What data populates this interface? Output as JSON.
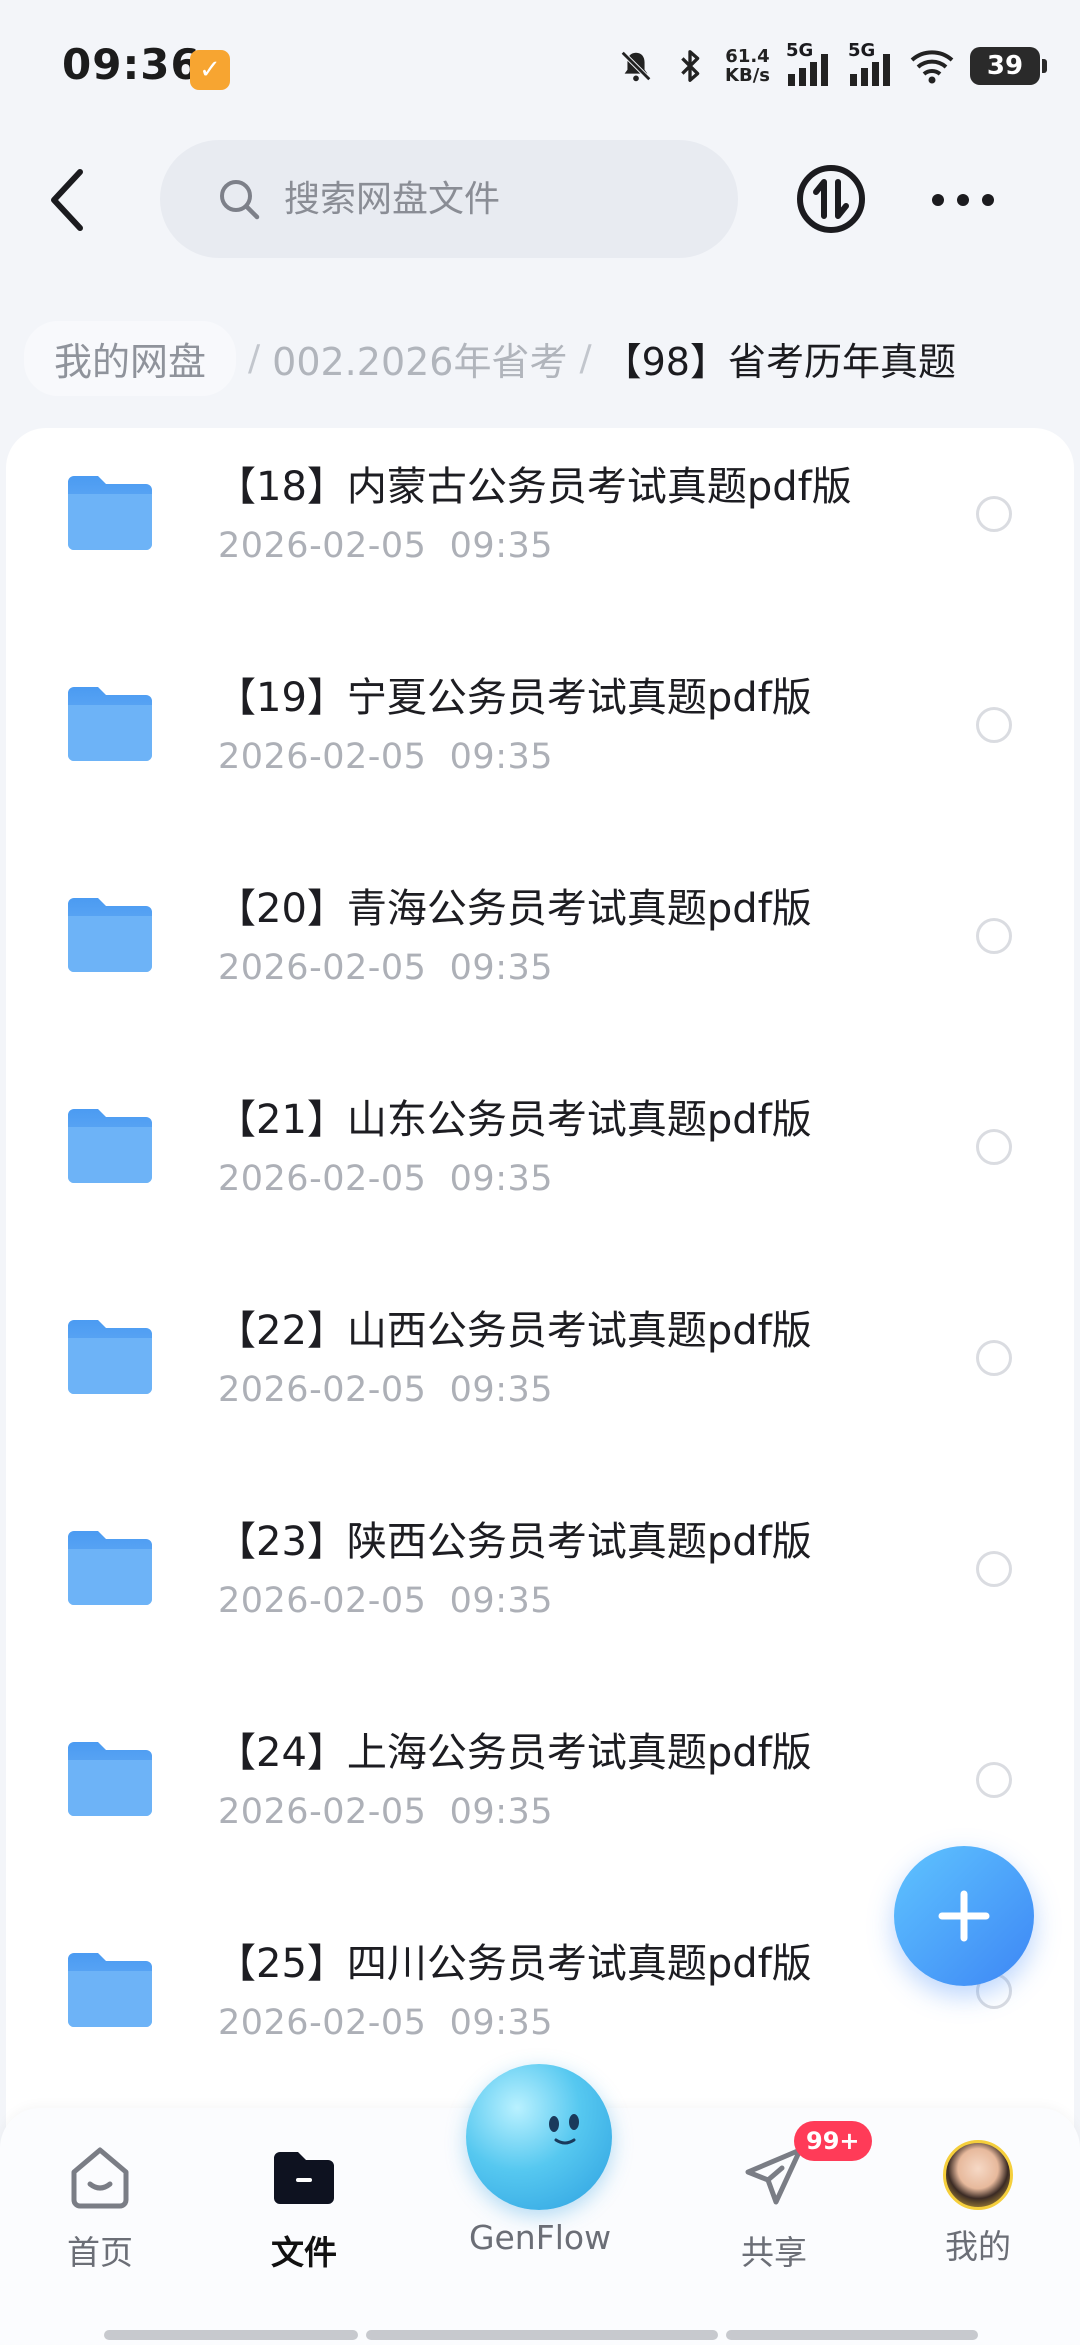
{
  "status_bar": {
    "time": "09:36",
    "app_badge_icon": "app-notification-icon",
    "net_speed_value": "61.4",
    "net_speed_unit": "KB/s",
    "signal1": "5G",
    "signal2": "5G",
    "battery": "39"
  },
  "header": {
    "search_placeholder": "搜索网盘文件"
  },
  "breadcrumb": {
    "home": "我的网盘",
    "mid": "002.2026年省考",
    "current": "【98】省考历年真题",
    "separator": "/"
  },
  "files": [
    {
      "name": "【18】内蒙古公务员考试真题pdf版",
      "date": "2026-02-05  09:35"
    },
    {
      "name": "【19】宁夏公务员考试真题pdf版",
      "date": "2026-02-05  09:35"
    },
    {
      "name": "【20】青海公务员考试真题pdf版",
      "date": "2026-02-05  09:35"
    },
    {
      "name": "【21】山东公务员考试真题pdf版",
      "date": "2026-02-05  09:35"
    },
    {
      "name": "【22】山西公务员考试真题pdf版",
      "date": "2026-02-05  09:35"
    },
    {
      "name": "【23】陕西公务员考试真题pdf版",
      "date": "2026-02-05  09:35"
    },
    {
      "name": "【24】上海公务员考试真题pdf版",
      "date": "2026-02-05  09:35"
    },
    {
      "name": "【25】四川公务员考试真题pdf版",
      "date": "2026-02-05  09:35"
    }
  ],
  "bottom_nav": {
    "home": "首页",
    "files": "文件",
    "genflow": "GenFlow",
    "share": "共享",
    "share_badge": "99+",
    "mine": "我的"
  },
  "colors": {
    "accent": "#3d86f5",
    "folder": "#5aa8f5",
    "badge": "#ff3b58"
  }
}
